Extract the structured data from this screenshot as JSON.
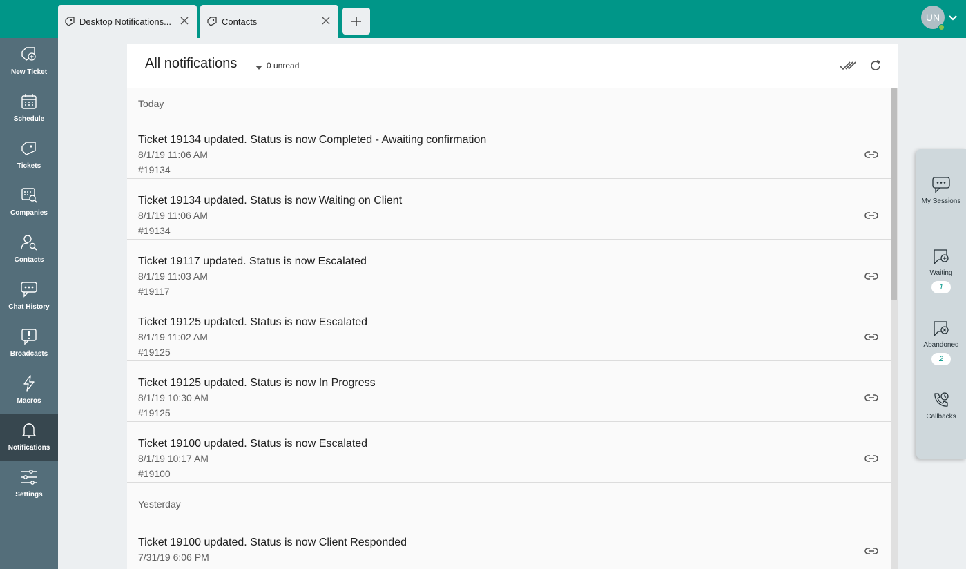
{
  "tabs": [
    {
      "label": "Desktop Notifications..."
    },
    {
      "label": "Contacts"
    }
  ],
  "user": {
    "initials": "UN"
  },
  "nav": [
    {
      "label": "New Ticket",
      "icon": "ticket-plus-icon"
    },
    {
      "label": "Schedule",
      "icon": "calendar-icon"
    },
    {
      "label": "Tickets",
      "icon": "ticket-icon"
    },
    {
      "label": "Companies",
      "icon": "companies-search-icon"
    },
    {
      "label": "Contacts",
      "icon": "contact-search-icon"
    },
    {
      "label": "Chat History",
      "icon": "chat-history-icon"
    },
    {
      "label": "Broadcasts",
      "icon": "broadcast-icon"
    },
    {
      "label": "Macros",
      "icon": "lightning-icon"
    },
    {
      "label": "Notifications",
      "icon": "bell-icon"
    },
    {
      "label": "Settings",
      "icon": "sliders-icon"
    }
  ],
  "panel": {
    "title": "All notifications",
    "unread": "0 unread"
  },
  "groups": [
    {
      "label": "Today",
      "items": [
        {
          "title": "Ticket 19134 updated. Status is now Completed - Awaiting confirmation",
          "time": "8/1/19 11:06 AM",
          "id": "#19134"
        },
        {
          "title": "Ticket 19134 updated. Status is now Waiting on Client",
          "time": "8/1/19 11:06 AM",
          "id": "#19134"
        },
        {
          "title": "Ticket 19117 updated. Status is now Escalated",
          "time": "8/1/19 11:03 AM",
          "id": "#19117"
        },
        {
          "title": "Ticket 19125 updated. Status is now Escalated",
          "time": "8/1/19 11:02 AM",
          "id": "#19125"
        },
        {
          "title": "Ticket 19125 updated. Status is now In Progress",
          "time": "8/1/19 10:30 AM",
          "id": "#19125"
        },
        {
          "title": "Ticket 19100 updated. Status is now Escalated",
          "time": "8/1/19 10:17 AM",
          "id": "#19100"
        }
      ]
    },
    {
      "label": "Yesterday",
      "items": [
        {
          "title": "Ticket 19100 updated. Status is now Client Responded",
          "time": "7/31/19 6:06 PM",
          "id": ""
        }
      ]
    }
  ],
  "dock": [
    {
      "label": "My Sessions",
      "badge": ""
    },
    {
      "label": "Waiting",
      "badge": "1"
    },
    {
      "label": "Abandoned",
      "badge": "2"
    },
    {
      "label": "Callbacks",
      "badge": ""
    }
  ],
  "colors": {
    "header": "#009688",
    "nav": "#546e7a",
    "nav_active": "#37474f",
    "accent": "#009688"
  }
}
